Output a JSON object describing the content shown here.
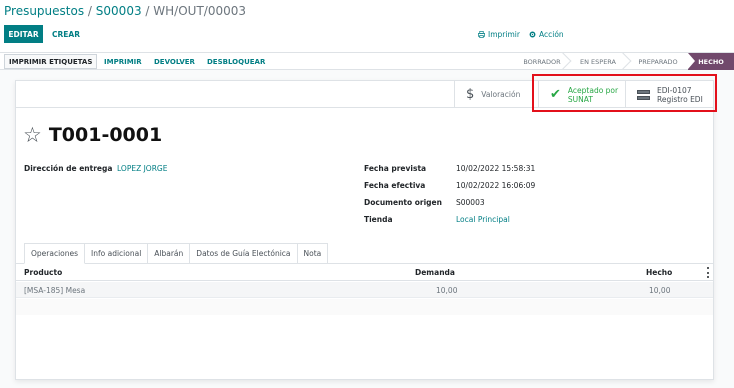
{
  "breadcrumb": {
    "parent": "Presupuestos",
    "order": "S00003",
    "current": "WH/OUT/00003",
    "separator": "/"
  },
  "control_panel": {
    "edit_label": "EDITAR",
    "create_label": "CREAR",
    "print_label": "Imprimir",
    "action_label": "Acción"
  },
  "statusbar": {
    "buttons": [
      "IMPRIMIR ETIQUETAS",
      "IMPRIMIR",
      "DEVOLVER",
      "DESBLOQUEAR"
    ],
    "stages": [
      "BORRADOR",
      "EN ESPERA",
      "PREPARADO",
      "HECHO"
    ],
    "active_stage": "HECHO"
  },
  "smart_buttons": {
    "valuation": "Valoración",
    "sunat_line1": "Aceptado por",
    "sunat_line2": "SUNAT",
    "edi_line1": "EDI-0107",
    "edi_line2": "Registro EDI"
  },
  "record": {
    "name": "T001-0001"
  },
  "fields": {
    "delivery_address_label": "Dirección de entrega",
    "delivery_address_value": "LOPEZ JORGE",
    "scheduled_date_label": "Fecha prevista",
    "scheduled_date_value": "10/02/2022 15:58:31",
    "effective_date_label": "Fecha efectiva",
    "effective_date_value": "10/02/2022 16:06:09",
    "source_doc_label": "Documento origen",
    "source_doc_value": "S00003",
    "store_label": "Tienda",
    "store_value": "Local Principal"
  },
  "tabs": [
    "Operaciones",
    "Info adicional",
    "Albarán",
    "Datos de Guía Electónica",
    "Nota"
  ],
  "table": {
    "headers": [
      "Producto",
      "Demanda",
      "Hecho"
    ],
    "rows": [
      {
        "product": "[MSA-185] Mesa",
        "demand": "10,00",
        "done": "10,00"
      }
    ]
  },
  "colors": {
    "accent": "#017e84",
    "active_stage": "#71496c",
    "highlight": "#e3101b",
    "success": "#28a745"
  }
}
